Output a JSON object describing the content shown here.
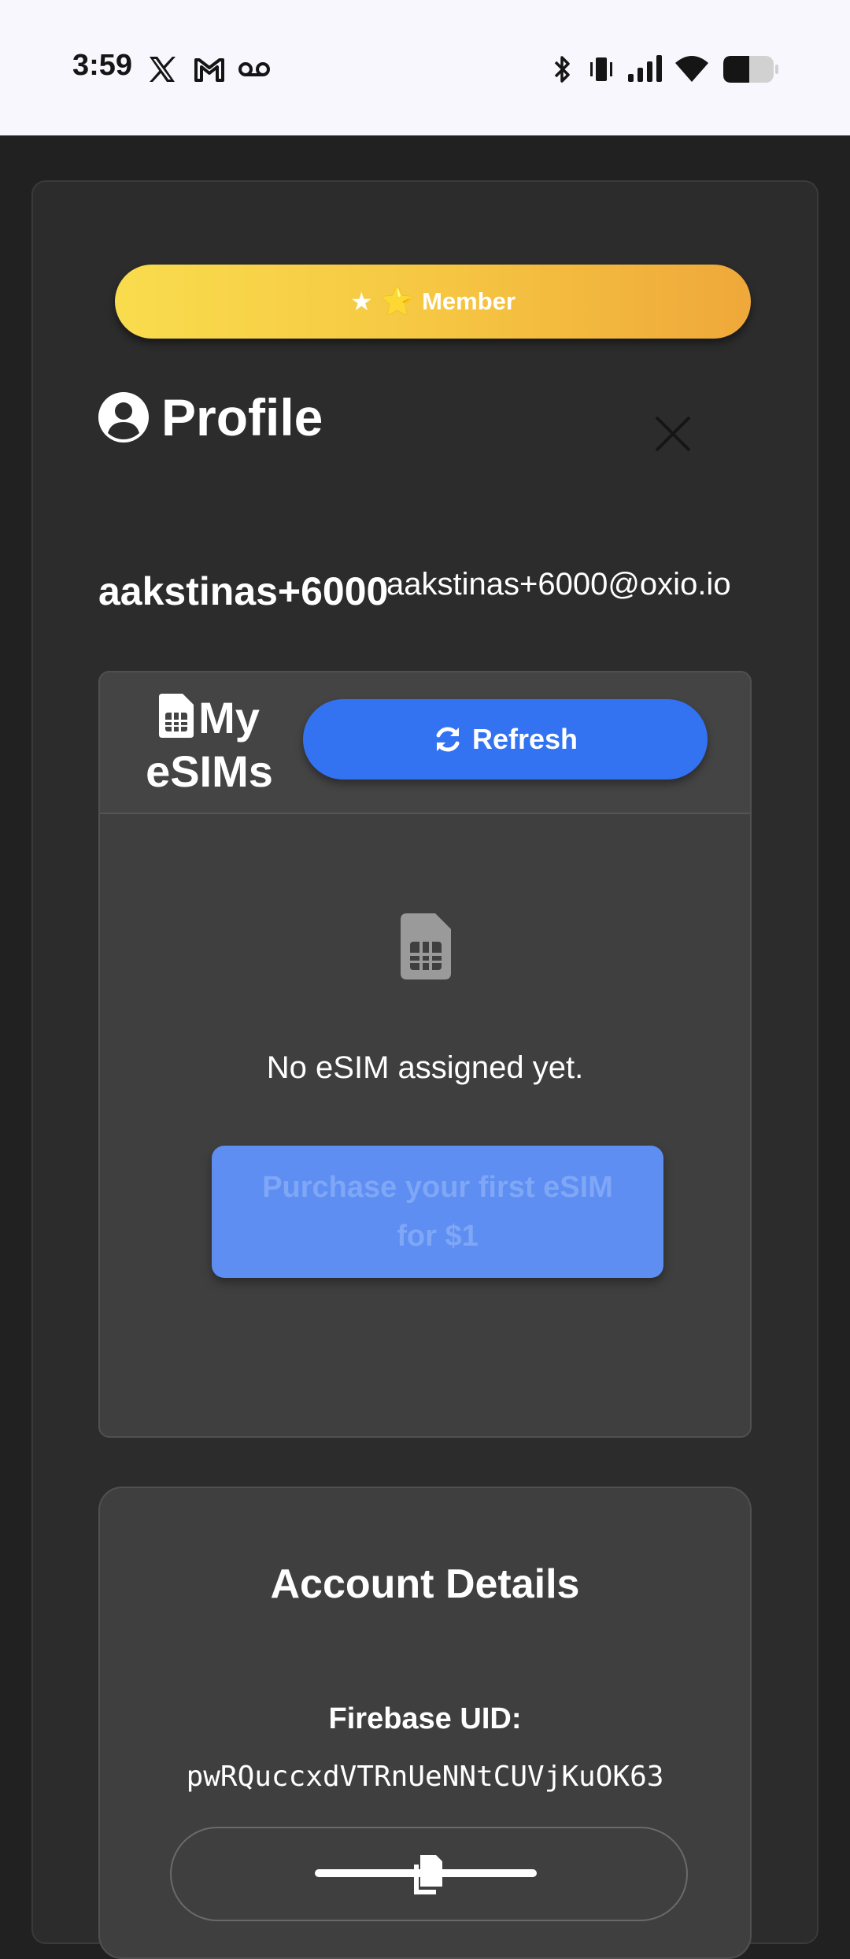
{
  "status_bar": {
    "time": "3:59",
    "left_icons": [
      "x-icon",
      "gmail-icon",
      "voicemail-icon"
    ],
    "right_icons": [
      "bluetooth-icon",
      "vibrate-icon",
      "signal-icon",
      "wifi-icon",
      "battery-icon"
    ]
  },
  "member_badge": {
    "star": "★",
    "emoji_star": "⭐",
    "label": "Member",
    "colors": [
      "#f9dc4e",
      "#efa83a"
    ]
  },
  "profile": {
    "title": "Profile",
    "icon": "user-circle-icon",
    "close_icon": "close-icon",
    "username": "aakstinas+6000",
    "email": "aakstinas+6000@oxio.io"
  },
  "esims": {
    "title": "My eSIMs",
    "refresh_label": "Refresh",
    "empty_text": "No eSIM assigned yet.",
    "purchase_label": "Purchase your first eSIM for $1",
    "accent": "#3373f2"
  },
  "account": {
    "title": "Account Details",
    "uid_label": "Firebase UID:",
    "uid_value": "pwRQuccxdVTRnUeNNtCUVjKuOK63",
    "copy_icon": "copy-icon"
  }
}
